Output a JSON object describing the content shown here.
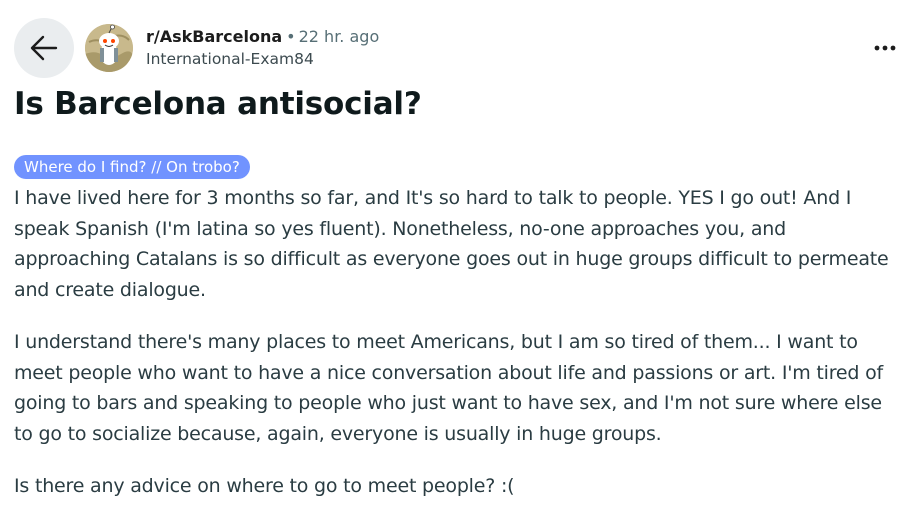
{
  "post": {
    "subreddit": "r/AskBarcelona",
    "separator": "•",
    "time": "22 hr. ago",
    "author": "International-Exam84",
    "title": "Is Barcelona antisocial?",
    "flair": "Where do I find? // On trobo?",
    "paragraphs": [
      "I have lived here for 3 months so far, and It's so hard to talk to people. YES I go out! And I speak Spanish (I'm latina so yes fluent). Nonetheless, no-one approaches you, and approaching Catalans is so difficult as everyone goes out in huge groups difficult to permeate and create dialogue.",
      "I understand there's many places to meet Americans, but I am so tired of them... I want to meet people who want to have a nice conversation about life and passions or art. I'm tired of going to bars and speaking to people who just want to have sex, and I'm not sure where else to go to socialize because, again, everyone is usually in huge groups.",
      "Is there any advice on where to go to meet people? :("
    ]
  },
  "icons": {
    "back": "arrow-left-icon",
    "more": "ellipsis-icon",
    "avatar": "subreddit-avatar"
  },
  "colors": {
    "flair_bg": "#7193ff",
    "flair_text": "#ffffff",
    "back_button_bg": "#eaedef",
    "meta_gray": "#576f76",
    "body_text": "#2a3c42"
  }
}
